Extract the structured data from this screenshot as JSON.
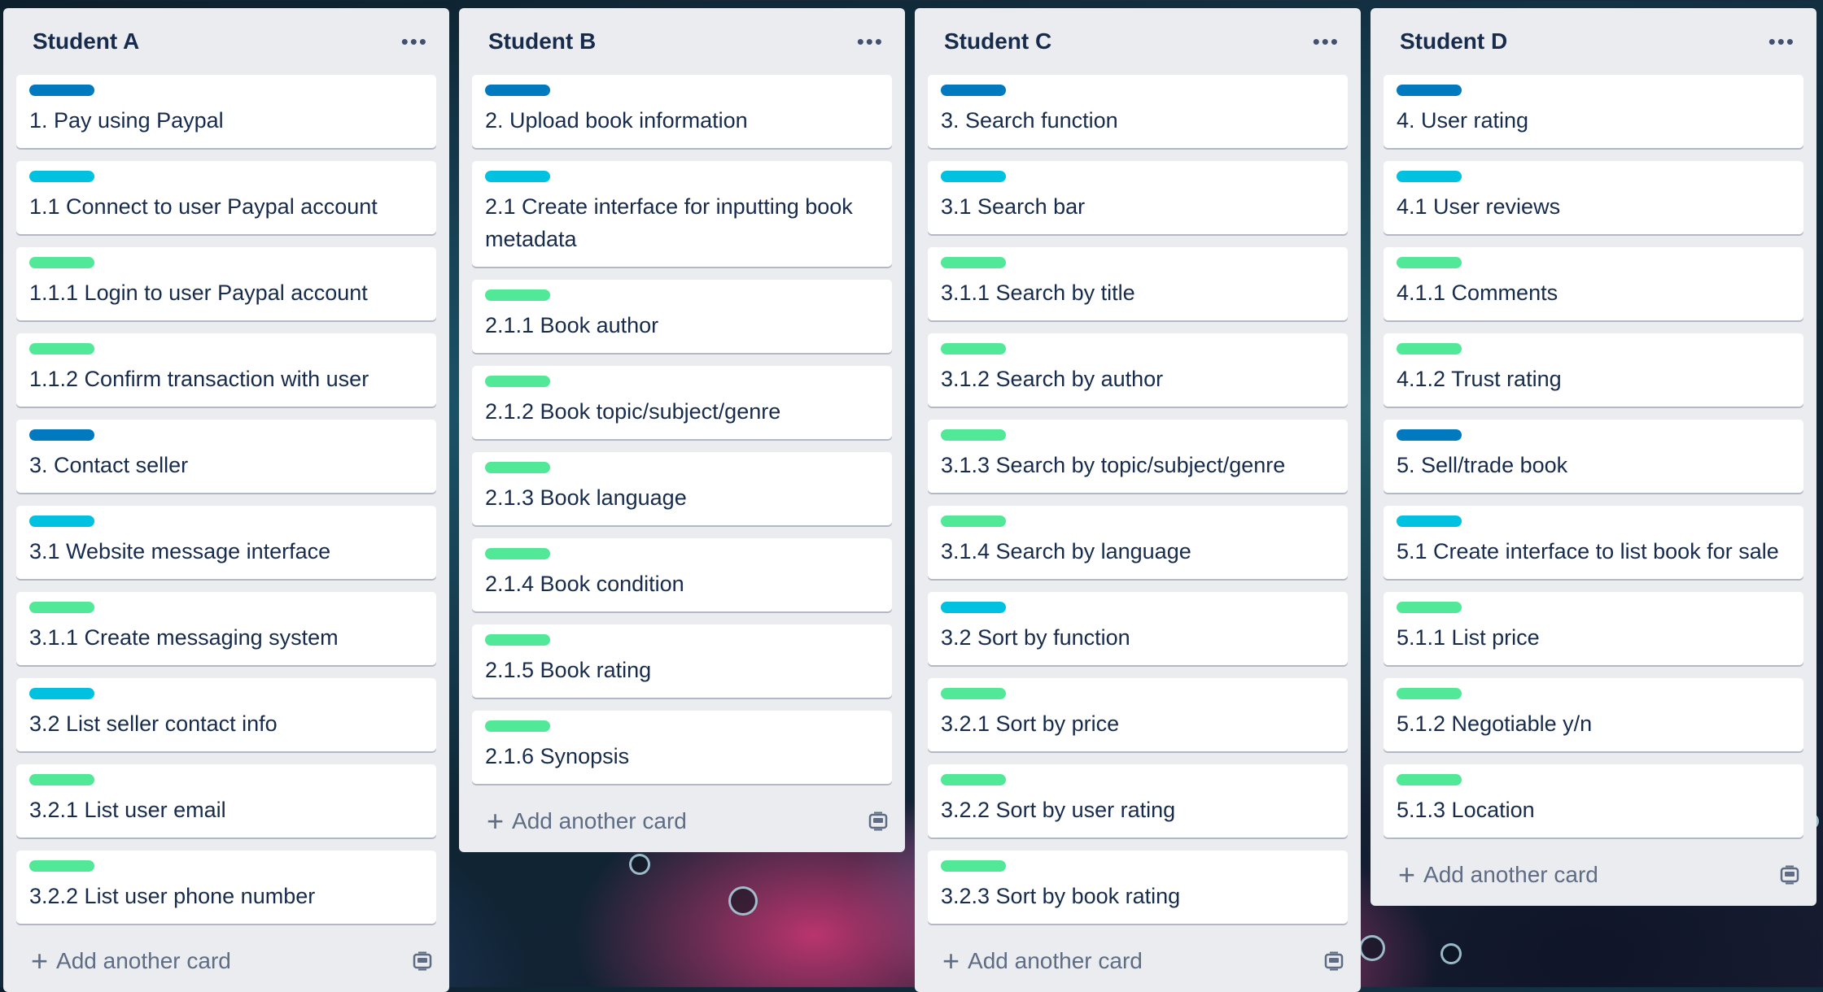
{
  "colors": {
    "label_blue": "#0079bf",
    "label_sky": "#00c2e0",
    "label_green": "#51e898",
    "list_bg": "#ebecf0"
  },
  "lists": [
    {
      "title": "Student A",
      "menu_icon": "more-icon",
      "cards": [
        {
          "label": "blue",
          "text": "1. Pay using Paypal"
        },
        {
          "label": "sky",
          "text": "1.1 Connect to user Paypal account"
        },
        {
          "label": "green",
          "text": "1.1.1 Login to user Paypal account"
        },
        {
          "label": "green",
          "text": "1.1.2 Confirm transaction with user"
        },
        {
          "label": "blue",
          "text": "3. Contact seller"
        },
        {
          "label": "sky",
          "text": "3.1 Website message interface"
        },
        {
          "label": "green",
          "text": "3.1.1 Create messaging system"
        },
        {
          "label": "sky",
          "text": "3.2 List seller contact info"
        },
        {
          "label": "green",
          "text": "3.2.1 List user email"
        },
        {
          "label": "green",
          "text": "3.2.2 List user phone number"
        }
      ],
      "add_card_label": "Add another card"
    },
    {
      "title": "Student B",
      "menu_icon": "more-icon",
      "cards": [
        {
          "label": "blue",
          "text": "2. Upload book information"
        },
        {
          "label": "sky",
          "text": "2.1 Create interface for inputting book metadata"
        },
        {
          "label": "green",
          "text": "2.1.1 Book author"
        },
        {
          "label": "green",
          "text": "2.1.2 Book topic/subject/genre"
        },
        {
          "label": "green",
          "text": "2.1.3 Book language"
        },
        {
          "label": "green",
          "text": "2.1.4 Book condition"
        },
        {
          "label": "green",
          "text": "2.1.5 Book rating"
        },
        {
          "label": "green",
          "text": "2.1.6 Synopsis"
        }
      ],
      "add_card_label": "Add another card"
    },
    {
      "title": "Student C",
      "menu_icon": "more-icon",
      "cards": [
        {
          "label": "blue",
          "text": "3. Search function"
        },
        {
          "label": "sky",
          "text": "3.1 Search bar"
        },
        {
          "label": "green",
          "text": "3.1.1 Search by title"
        },
        {
          "label": "green",
          "text": "3.1.2 Search by author"
        },
        {
          "label": "green",
          "text": "3.1.3 Search by topic/subject/genre"
        },
        {
          "label": "green",
          "text": "3.1.4 Search by language"
        },
        {
          "label": "sky",
          "text": "3.2 Sort by function"
        },
        {
          "label": "green",
          "text": "3.2.1 Sort by price"
        },
        {
          "label": "green",
          "text": "3.2.2 Sort by user rating"
        },
        {
          "label": "green",
          "text": "3.2.3 Sort by book rating"
        }
      ],
      "add_card_label": "Add another card"
    },
    {
      "title": "Student D",
      "menu_icon": "more-icon",
      "cards": [
        {
          "label": "blue",
          "text": "4. User rating"
        },
        {
          "label": "sky",
          "text": "4.1 User reviews"
        },
        {
          "label": "green",
          "text": "4.1.1 Comments"
        },
        {
          "label": "green",
          "text": "4.1.2 Trust rating"
        },
        {
          "label": "blue",
          "text": "5. Sell/trade book"
        },
        {
          "label": "sky",
          "text": "5.1 Create interface to list book for sale"
        },
        {
          "label": "green",
          "text": "5.1.1 List price"
        },
        {
          "label": "green",
          "text": "5.1.2 Negotiable y/n"
        },
        {
          "label": "green",
          "text": "5.1.3 Location"
        }
      ],
      "add_card_label": "Add another card"
    }
  ]
}
